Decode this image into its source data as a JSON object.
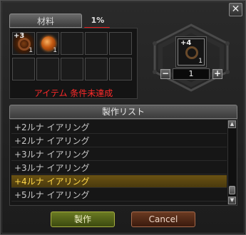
{
  "window": {
    "close_symbol": "✕",
    "close_icon": "close-icon"
  },
  "tabs": {
    "materials_label": "材料",
    "percent_label": "1%"
  },
  "materials": {
    "slots": [
      {
        "plus": "+3",
        "count": "1",
        "icon": "earring-icon"
      },
      {
        "plus": "",
        "count": "1",
        "icon": "orb-icon"
      }
    ],
    "condition_text": "アイテム 条件未達成"
  },
  "result": {
    "plus": "+4",
    "count": "1",
    "icon": "earring-icon",
    "quantity": "1",
    "minus_label": "−",
    "plus_label": "+"
  },
  "craft_list": {
    "header": "製作リスト",
    "items": [
      {
        "label": "+2ルナ イアリング",
        "selected": false
      },
      {
        "label": "+2ルナ イアリング",
        "selected": false
      },
      {
        "label": "+3ルナ イアリング",
        "selected": false
      },
      {
        "label": "+3ルナ イアリング",
        "selected": false
      },
      {
        "label": "+4ルナ イアリング",
        "selected": true
      },
      {
        "label": "+5ルナ イアリング",
        "selected": false
      }
    ],
    "scroll_up": "▲",
    "scroll_down": "▼"
  },
  "buttons": {
    "craft_label": "製作",
    "cancel_label": "Cancel"
  },
  "colors": {
    "warning": "#ff2a2a",
    "selected_text": "#ffd84a",
    "underline": "#e31a1a"
  }
}
